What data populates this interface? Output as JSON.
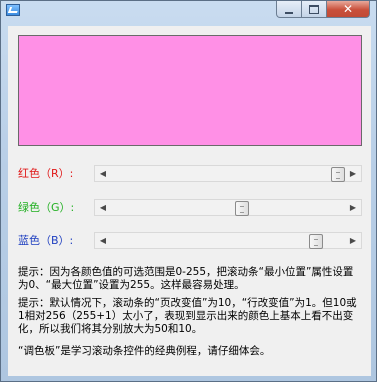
{
  "window": {
    "icon": "app-icon"
  },
  "colors": {
    "preview": "#FF90E6",
    "red_label": "#E01818",
    "green_label": "#22B022",
    "blue_label": "#2040C0"
  },
  "sliders": [
    {
      "label": "红色（R）:",
      "min": 0,
      "max": 255,
      "value": 255
    },
    {
      "label": "绿色（G）:",
      "min": 0,
      "max": 255,
      "value": 144
    },
    {
      "label": "蓝色（B）:",
      "min": 0,
      "max": 255,
      "value": 230
    }
  ],
  "tips": {
    "tip1": "提示：因为各颜色值的可选范围是0-255，把滚动条“最小位置”属性设置为0、“最大位置”设置为255。这样最容易处理。",
    "tip2": "提示：默认情况下，滚动条的“页改变值”为10，“行改变值”为1。但10或1相对256（255+1）太小了，表现到显示出来的颜色上基本上看不出变化，所以我们将其分别放大为50和10。",
    "tip3": "“调色板”是学习滚动条控件的经典例程，请仔细体会。"
  }
}
